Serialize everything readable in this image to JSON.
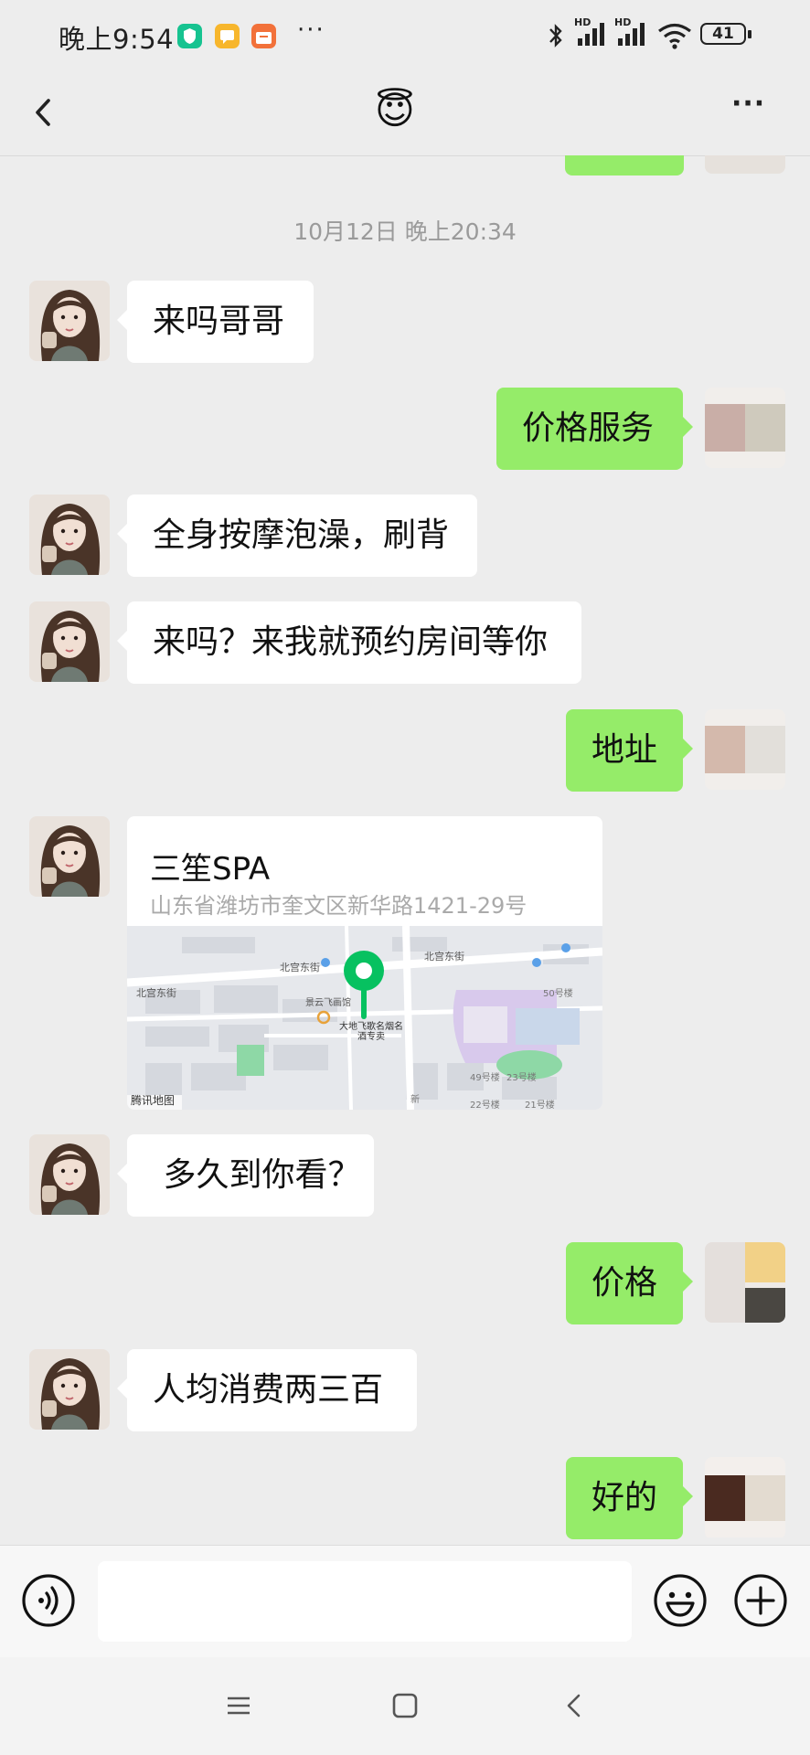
{
  "status_bar": {
    "time": "晚上9:54",
    "overflow_glyph": "···",
    "signal_label_1": "HD",
    "signal_label_2": "HD",
    "battery": "41"
  },
  "nav": {
    "title_emoji": "😇",
    "more_glyph": "···"
  },
  "timestamp": "10月12日 晚上20:34",
  "messages": [
    {
      "side": "left",
      "text": "来吗哥哥"
    },
    {
      "side": "right",
      "text": "价格服务"
    },
    {
      "side": "left",
      "text": "全身按摩泡澡，刷背"
    },
    {
      "side": "left",
      "text": "来吗？来我就预约房间等你"
    },
    {
      "side": "right",
      "text": "地址"
    },
    {
      "side": "left",
      "type": "location",
      "title": "三笙SPA",
      "address": "山东省潍坊市奎文区新华路1421-29号"
    },
    {
      "side": "left",
      "text": " 多久到你看？"
    },
    {
      "side": "right",
      "text": "价格"
    },
    {
      "side": "left",
      "text": "人均消费两三百"
    },
    {
      "side": "right",
      "text": "好的"
    }
  ],
  "map": {
    "labels": {
      "street_1": "北宫东街",
      "street_2": "北宫东街",
      "street_3": "北宫东街",
      "hotel": "景云飞画馆",
      "poi": "大地飞歌名烟名酒专卖",
      "bldg_50": "50号楼",
      "bldg_49": "49号楼",
      "bldg_23": "23号楼",
      "bldg_22": "22号楼",
      "bldg_21": "21号楼",
      "road_v": "新",
      "provider": "腾讯地图"
    },
    "colors": {
      "pin": "#07c160",
      "park": "#8ed8a6",
      "stadium": "#d8c9ec"
    }
  },
  "colors": {
    "my_bubble": "#95ec69",
    "their_bubble": "#ffffff",
    "background": "#ededed"
  },
  "icons": {
    "back": "chevron-left-icon",
    "voice": "voice-icon",
    "emoji": "emoji-icon",
    "plus": "plus-icon",
    "menu": "menu-icon",
    "home": "home-icon",
    "sys_back": "back-icon"
  }
}
